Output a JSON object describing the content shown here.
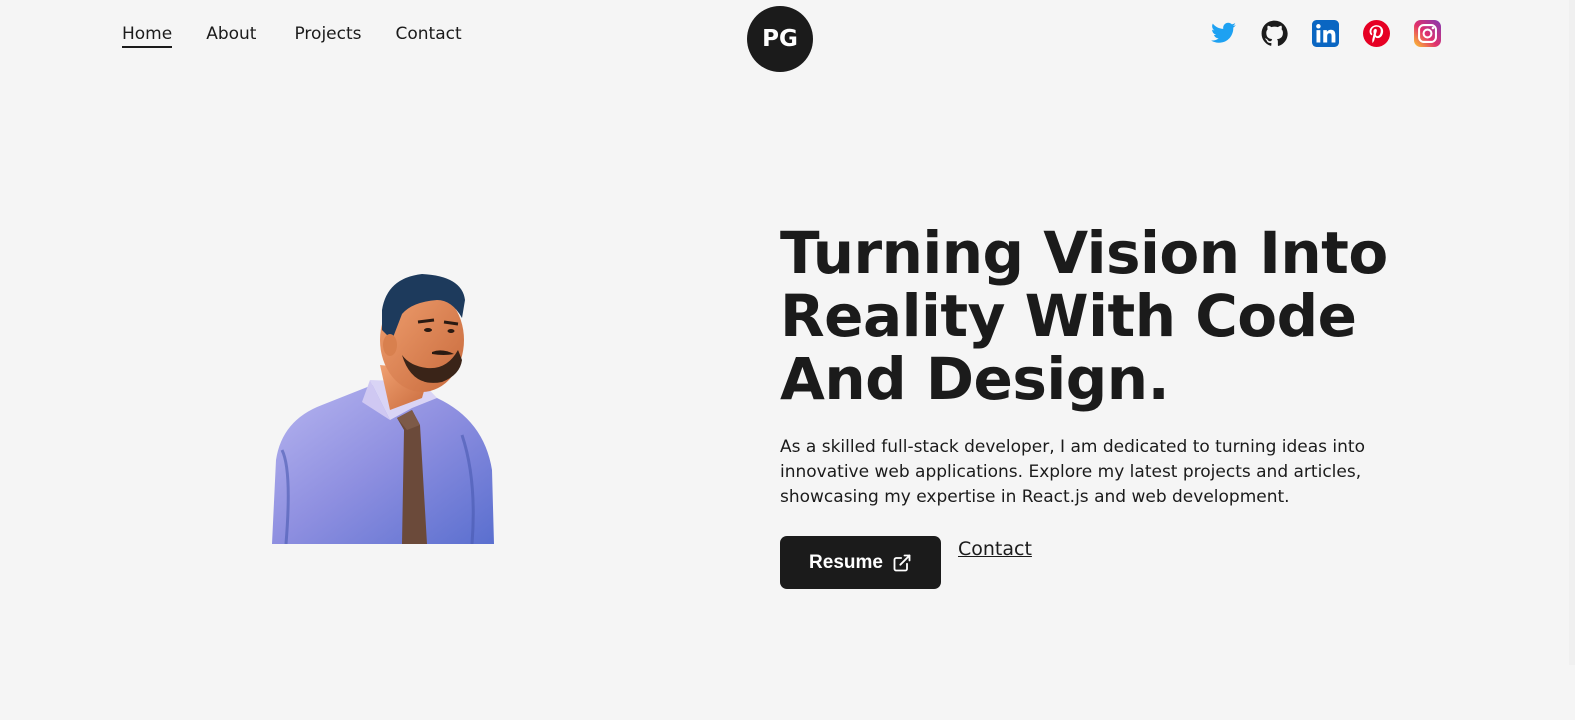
{
  "nav": {
    "links": [
      {
        "label": "Home",
        "active": true
      },
      {
        "label": "About",
        "active": false
      },
      {
        "label": "Projects",
        "active": false
      },
      {
        "label": "Contact",
        "active": false
      }
    ],
    "logo_text": "PG"
  },
  "socials": [
    {
      "name": "twitter-icon",
      "color": "#1da1f2"
    },
    {
      "name": "github-icon",
      "color": "#1b1b1b"
    },
    {
      "name": "linkedin-icon",
      "color": "#0a66c2"
    },
    {
      "name": "pinterest-icon",
      "color": "#e60023"
    },
    {
      "name": "instagram-icon",
      "color": "#e1306c"
    }
  ],
  "hero": {
    "headline_lines": [
      "Turning Vision Into",
      "Reality With Code",
      "And Design."
    ],
    "description": "As a skilled full-stack developer, I am dedicated to turning ideas into innovative web applications. Explore my latest projects and articles, showcasing my expertise in React.js and web development.",
    "resume_label": "Resume",
    "contact_label": "Contact"
  },
  "colors": {
    "background": "#f5f5f5",
    "dark": "#1b1b1b"
  }
}
